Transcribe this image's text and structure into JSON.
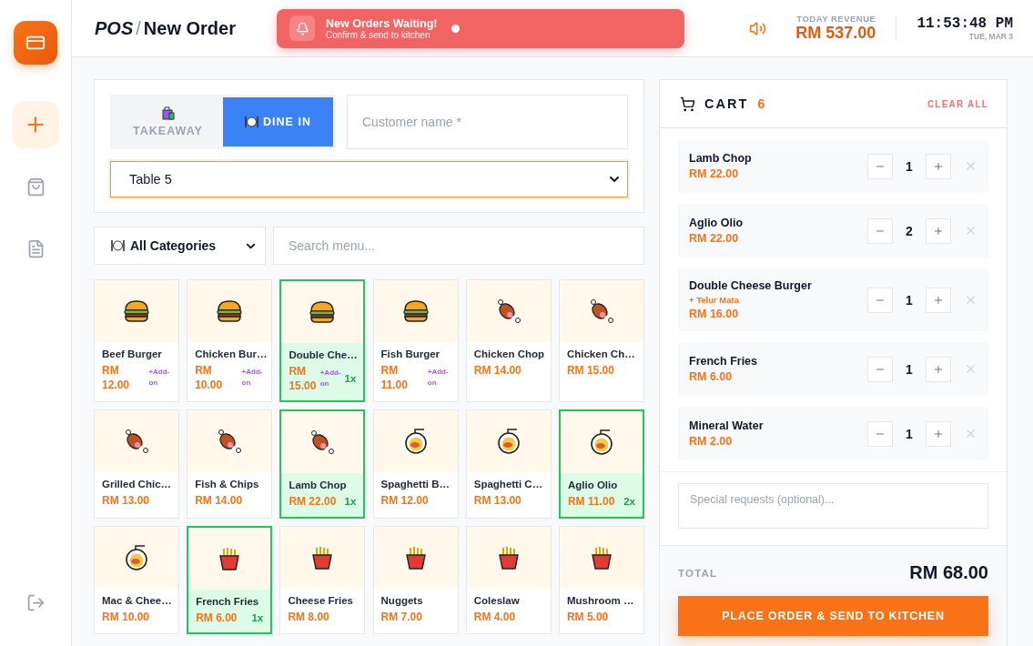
{
  "header": {
    "brand": "POS",
    "separator": "/",
    "title": "New Order",
    "notification": {
      "title": "New Orders Waiting!",
      "subtitle": "Confirm & send to kitchen",
      "unread": true
    },
    "revenue_label": "TODAY REVENUE",
    "revenue": "RM 537.00",
    "time": "11:53:48 PM",
    "date": "TUE, MAR 3"
  },
  "sidebar": {
    "items": [
      {
        "kind": "new",
        "selected": true
      },
      {
        "kind": "orders",
        "selected": false
      },
      {
        "kind": "reports",
        "selected": false
      }
    ]
  },
  "order_type": {
    "options": [
      {
        "kind": "takeaway",
        "label": "TAKEAWAY",
        "selected": false
      },
      {
        "kind": "dine_in",
        "label": "DINE IN",
        "selected": true
      }
    ],
    "customer": {
      "placeholder": "Customer name *"
    },
    "table": {
      "value": "Table 5"
    }
  },
  "filters": {
    "category": "All Categories",
    "search": {
      "placeholder": "Search menu..."
    }
  },
  "menu": [
    {
      "name": "Beef Burger",
      "price": "RM 12.00",
      "addon": "+Add-on",
      "kind": "burger",
      "selected": false
    },
    {
      "name": "Chicken Bur…",
      "price": "RM 10.00",
      "addon": "+Add-on",
      "kind": "burger",
      "selected": false
    },
    {
      "name": "Double Che…",
      "price": "RM 15.00",
      "addon": "+Add-on",
      "kind": "burger",
      "selected": true,
      "qty": "1x"
    },
    {
      "name": "Fish Burger",
      "price": "RM 11.00",
      "addon": "+Add-on",
      "kind": "burger",
      "selected": false
    },
    {
      "name": "Chicken Chop",
      "price": "RM 14.00",
      "kind": "meat",
      "selected": false
    },
    {
      "name": "Chicken Ch…",
      "price": "RM 15.00",
      "kind": "meat",
      "selected": false
    },
    {
      "name": "Grilled Chic…",
      "price": "RM 13.00",
      "kind": "meat",
      "selected": false
    },
    {
      "name": "Fish & Chips",
      "price": "RM 14.00",
      "kind": "meat",
      "selected": false
    },
    {
      "name": "Lamb Chop",
      "price": "RM 22.00",
      "kind": "meat",
      "selected": true,
      "qty": "1x"
    },
    {
      "name": "Spaghetti B…",
      "price": "RM 12.00",
      "kind": "pasta",
      "selected": false
    },
    {
      "name": "Spaghetti C…",
      "price": "RM 13.00",
      "kind": "pasta",
      "selected": false
    },
    {
      "name": "Aglio Olio",
      "price": "RM 11.00",
      "kind": "pasta",
      "selected": true,
      "qty": "2x"
    },
    {
      "name": "Mac & Chee…",
      "price": "RM 10.00",
      "kind": "pasta",
      "selected": false
    },
    {
      "name": "French Fries",
      "price": "RM 6.00",
      "kind": "fries",
      "selected": true,
      "qty": "1x"
    },
    {
      "name": "Cheese Fries",
      "price": "RM 8.00",
      "kind": "fries",
      "selected": false
    },
    {
      "name": "Nuggets",
      "price": "RM 7.00",
      "kind": "fries",
      "selected": false
    },
    {
      "name": "Coleslaw",
      "price": "RM 4.00",
      "kind": "fries",
      "selected": false
    },
    {
      "name": "Mushroom …",
      "price": "RM 5.00",
      "kind": "fries",
      "selected": false
    }
  ],
  "cart": {
    "title": "CART",
    "count": "6",
    "clear": "CLEAR ALL",
    "items": [
      {
        "name": "Lamb Chop",
        "price": "RM 22.00",
        "qty": "1"
      },
      {
        "name": "Aglio Olio",
        "price": "RM 22.00",
        "qty": "2"
      },
      {
        "name": "Double Cheese Burger",
        "addon": "+ Telur Mata",
        "price": "RM 16.00",
        "qty": "1"
      },
      {
        "name": "French Fries",
        "price": "RM 6.00",
        "qty": "1"
      },
      {
        "name": "Mineral Water",
        "price": "RM 2.00",
        "qty": "1"
      }
    ],
    "notes": {
      "placeholder": "Special requests (optional)..."
    },
    "total_label": "TOTAL",
    "total": "RM 68.00",
    "submit": "PLACE ORDER & SEND TO KITCHEN"
  }
}
